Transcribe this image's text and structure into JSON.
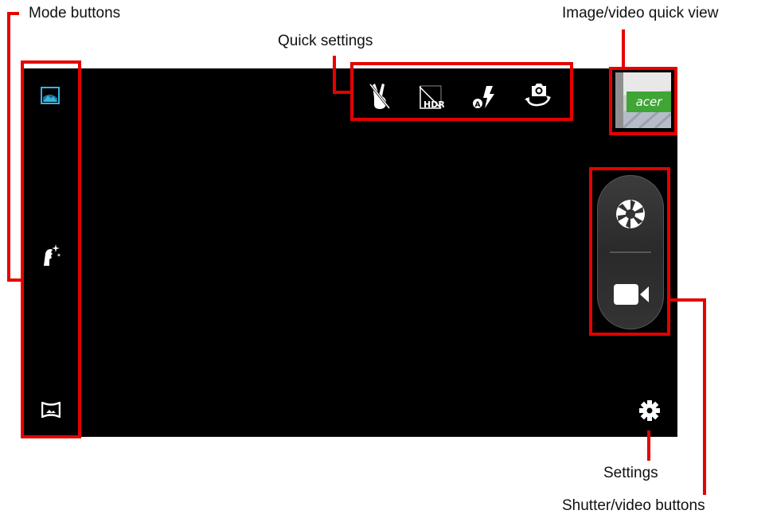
{
  "annotations": {
    "mode_buttons": "Mode buttons",
    "quick_settings": "Quick settings",
    "quick_view": "Image/video quick view",
    "settings": "Settings",
    "shutter_video": "Shutter/video buttons"
  },
  "modes": [
    {
      "name": "photo-mode",
      "icon": "picture-icon",
      "selected": true
    },
    {
      "name": "beauty-mode",
      "icon": "face-sparkle-icon",
      "selected": false
    },
    {
      "name": "panorama-mode",
      "icon": "panorama-icon",
      "selected": false
    }
  ],
  "quick_settings": [
    {
      "icon": "gesture-shot-icon"
    },
    {
      "icon": "hdr-off-icon",
      "text": "HDR"
    },
    {
      "icon": "flash-auto-icon",
      "text": "A"
    },
    {
      "icon": "switch-camera-icon"
    }
  ],
  "thumbnail": {
    "brand_text": "acer",
    "brand_color": "#3fa535"
  },
  "colors": {
    "accent": "#33b5e5",
    "annotation": "#e60000",
    "viewfinder": "#000000"
  }
}
